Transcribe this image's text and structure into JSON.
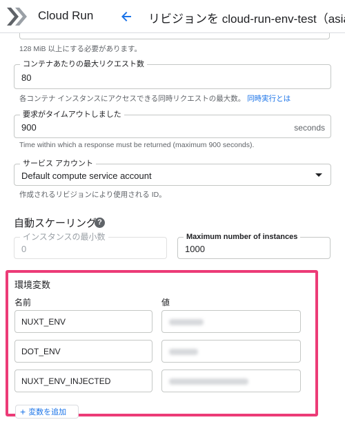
{
  "header": {
    "product": "Cloud Run",
    "title": "リビジョンを cloud-run-env-test（asia-n"
  },
  "memory_field": {
    "helper": "128 MiB 以上にする必要があります。"
  },
  "max_requests": {
    "label": "コンテナあたりの最大リクエスト数",
    "value": "80",
    "helper": "各コンテナ インスタンスにアクセスできる同時リクエストの最大数。",
    "link": "同時実行とは"
  },
  "timeout": {
    "label": "要求がタイムアウトしました",
    "value": "900",
    "suffix": "seconds",
    "helper": "Time within which a response must be returned (maximum 900 seconds)."
  },
  "service_account": {
    "label": "サービス アカウント",
    "value": "Default compute service account",
    "helper": "作成されるリビジョンにより使用される ID。"
  },
  "autoscaling": {
    "title": "自動スケーリング",
    "help": "?",
    "min_label": "インスタンスの最小数",
    "min_value": "0",
    "max_label": "Maximum number of instances",
    "max_value": "1000"
  },
  "env": {
    "title": "環境変数",
    "name_header": "名前",
    "value_header": "値",
    "rows": [
      {
        "name": "NUXT_ENV"
      },
      {
        "name": "DOT_ENV"
      },
      {
        "name": "NUXT_ENV_INJECTED"
      }
    ],
    "add_label": "変数を追加",
    "add_icon": "+"
  },
  "colors": {
    "highlight": "#ec3b77",
    "link": "#1a73e8"
  }
}
